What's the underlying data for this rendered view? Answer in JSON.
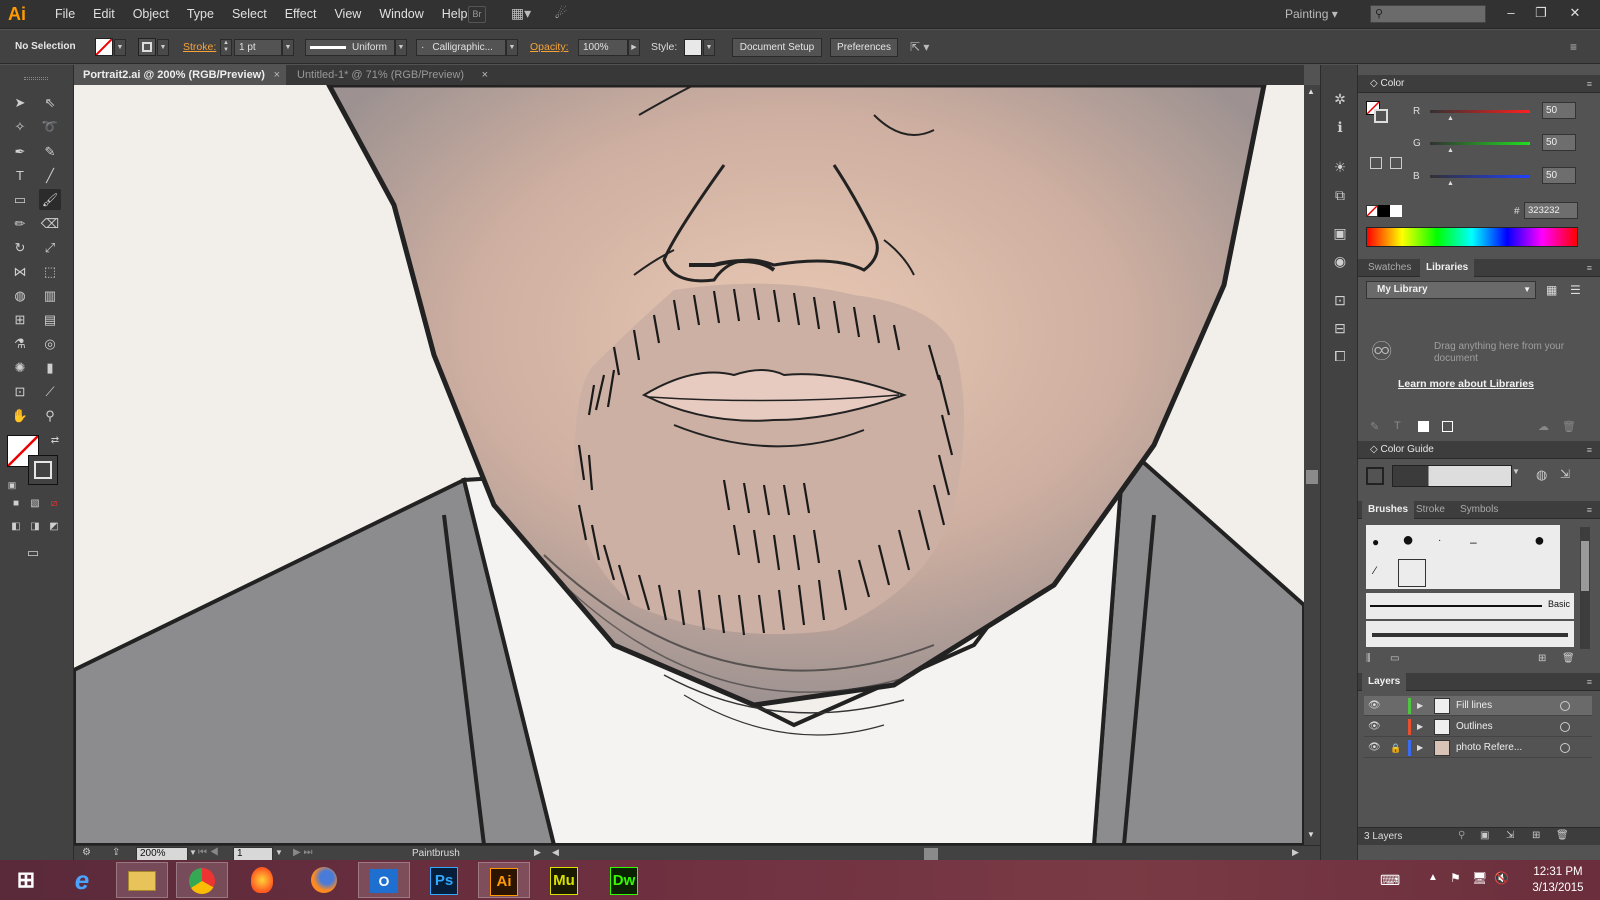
{
  "app": {
    "logo": "Ai"
  },
  "menu": [
    "File",
    "Edit",
    "Object",
    "Type",
    "Select",
    "Effect",
    "View",
    "Window",
    "Help"
  ],
  "menubar_buttons": {
    "bridge": "Br"
  },
  "workspace": {
    "label": "Painting"
  },
  "window_controls": {
    "minimize": "–",
    "restore": "❐",
    "close": "✕"
  },
  "control": {
    "selection": "No Selection",
    "stroke_label": "Stroke:",
    "stroke_weight": "1 pt",
    "profile": "Uniform",
    "brush": "Calligraphic...",
    "opacity_label": "Opacity:",
    "opacity": "100%",
    "style_label": "Style:",
    "doc_setup": "Document Setup",
    "preferences": "Preferences"
  },
  "tabs": [
    {
      "label": "Portrait2.ai @ 200% (RGB/Preview)",
      "close": "×"
    },
    {
      "label": "Untitled-1* @ 71% (RGB/Preview)",
      "close": "×"
    }
  ],
  "statusbar": {
    "zoom": "200%",
    "page": "1",
    "tool": "Paintbrush"
  },
  "color_panel": {
    "title": "Color",
    "r_label": "R",
    "r": "50",
    "g_label": "G",
    "g": "50",
    "b_label": "B",
    "b": "50",
    "hex_label": "#",
    "hex": "323232"
  },
  "libraries_panel": {
    "tabs": [
      "Swatches",
      "Libraries"
    ],
    "library": "My Library",
    "drag_hint": "Drag anything here from your document",
    "learn_more": "Learn more about Libraries"
  },
  "color_guide": {
    "title": "Color Guide"
  },
  "brushes_panel": {
    "tabs": [
      "Brushes",
      "Stroke",
      "Symbols"
    ],
    "basic_label": "Basic"
  },
  "layers_panel": {
    "title": "Layers",
    "layers": [
      {
        "name": "Fill lines",
        "color": "#4fc43f"
      },
      {
        "name": "Outlines",
        "color": "#e8502e"
      },
      {
        "name": "photo Refere...",
        "color": "#3a6cf0"
      }
    ],
    "count": "3 Layers"
  },
  "taskbar": {
    "apps": [
      "e",
      "",
      "",
      "",
      "",
      "",
      "Ps",
      "Ai",
      "Mu",
      "Dw"
    ],
    "time": "12:31 PM",
    "date": "3/13/2015"
  }
}
